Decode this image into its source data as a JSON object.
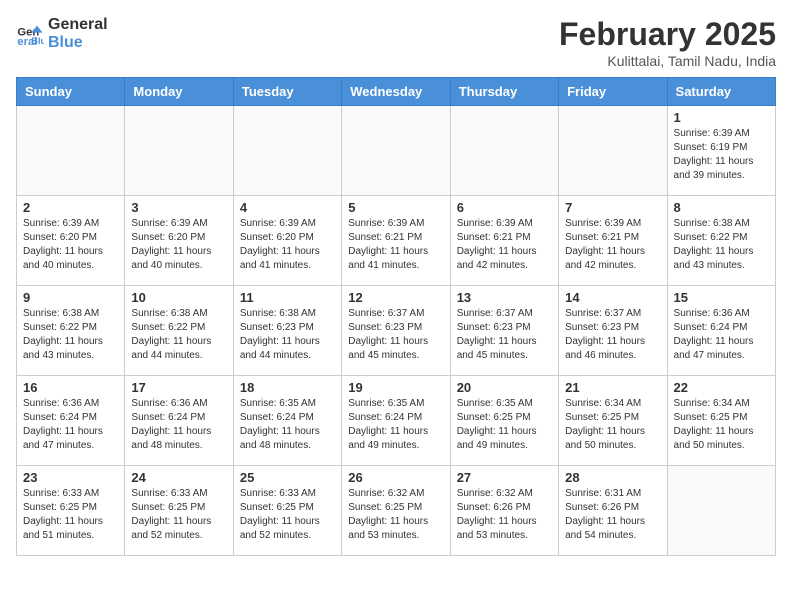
{
  "logo": {
    "general": "General",
    "blue": "Blue"
  },
  "title": "February 2025",
  "location": "Kulittalai, Tamil Nadu, India",
  "weekdays": [
    "Sunday",
    "Monday",
    "Tuesday",
    "Wednesday",
    "Thursday",
    "Friday",
    "Saturday"
  ],
  "weeks": [
    [
      {
        "day": "",
        "info": ""
      },
      {
        "day": "",
        "info": ""
      },
      {
        "day": "",
        "info": ""
      },
      {
        "day": "",
        "info": ""
      },
      {
        "day": "",
        "info": ""
      },
      {
        "day": "",
        "info": ""
      },
      {
        "day": "1",
        "info": "Sunrise: 6:39 AM\nSunset: 6:19 PM\nDaylight: 11 hours\nand 39 minutes."
      }
    ],
    [
      {
        "day": "2",
        "info": "Sunrise: 6:39 AM\nSunset: 6:20 PM\nDaylight: 11 hours\nand 40 minutes."
      },
      {
        "day": "3",
        "info": "Sunrise: 6:39 AM\nSunset: 6:20 PM\nDaylight: 11 hours\nand 40 minutes."
      },
      {
        "day": "4",
        "info": "Sunrise: 6:39 AM\nSunset: 6:20 PM\nDaylight: 11 hours\nand 41 minutes."
      },
      {
        "day": "5",
        "info": "Sunrise: 6:39 AM\nSunset: 6:21 PM\nDaylight: 11 hours\nand 41 minutes."
      },
      {
        "day": "6",
        "info": "Sunrise: 6:39 AM\nSunset: 6:21 PM\nDaylight: 11 hours\nand 42 minutes."
      },
      {
        "day": "7",
        "info": "Sunrise: 6:39 AM\nSunset: 6:21 PM\nDaylight: 11 hours\nand 42 minutes."
      },
      {
        "day": "8",
        "info": "Sunrise: 6:38 AM\nSunset: 6:22 PM\nDaylight: 11 hours\nand 43 minutes."
      }
    ],
    [
      {
        "day": "9",
        "info": "Sunrise: 6:38 AM\nSunset: 6:22 PM\nDaylight: 11 hours\nand 43 minutes."
      },
      {
        "day": "10",
        "info": "Sunrise: 6:38 AM\nSunset: 6:22 PM\nDaylight: 11 hours\nand 44 minutes."
      },
      {
        "day": "11",
        "info": "Sunrise: 6:38 AM\nSunset: 6:23 PM\nDaylight: 11 hours\nand 44 minutes."
      },
      {
        "day": "12",
        "info": "Sunrise: 6:37 AM\nSunset: 6:23 PM\nDaylight: 11 hours\nand 45 minutes."
      },
      {
        "day": "13",
        "info": "Sunrise: 6:37 AM\nSunset: 6:23 PM\nDaylight: 11 hours\nand 45 minutes."
      },
      {
        "day": "14",
        "info": "Sunrise: 6:37 AM\nSunset: 6:23 PM\nDaylight: 11 hours\nand 46 minutes."
      },
      {
        "day": "15",
        "info": "Sunrise: 6:36 AM\nSunset: 6:24 PM\nDaylight: 11 hours\nand 47 minutes."
      }
    ],
    [
      {
        "day": "16",
        "info": "Sunrise: 6:36 AM\nSunset: 6:24 PM\nDaylight: 11 hours\nand 47 minutes."
      },
      {
        "day": "17",
        "info": "Sunrise: 6:36 AM\nSunset: 6:24 PM\nDaylight: 11 hours\nand 48 minutes."
      },
      {
        "day": "18",
        "info": "Sunrise: 6:35 AM\nSunset: 6:24 PM\nDaylight: 11 hours\nand 48 minutes."
      },
      {
        "day": "19",
        "info": "Sunrise: 6:35 AM\nSunset: 6:24 PM\nDaylight: 11 hours\nand 49 minutes."
      },
      {
        "day": "20",
        "info": "Sunrise: 6:35 AM\nSunset: 6:25 PM\nDaylight: 11 hours\nand 49 minutes."
      },
      {
        "day": "21",
        "info": "Sunrise: 6:34 AM\nSunset: 6:25 PM\nDaylight: 11 hours\nand 50 minutes."
      },
      {
        "day": "22",
        "info": "Sunrise: 6:34 AM\nSunset: 6:25 PM\nDaylight: 11 hours\nand 50 minutes."
      }
    ],
    [
      {
        "day": "23",
        "info": "Sunrise: 6:33 AM\nSunset: 6:25 PM\nDaylight: 11 hours\nand 51 minutes."
      },
      {
        "day": "24",
        "info": "Sunrise: 6:33 AM\nSunset: 6:25 PM\nDaylight: 11 hours\nand 52 minutes."
      },
      {
        "day": "25",
        "info": "Sunrise: 6:33 AM\nSunset: 6:25 PM\nDaylight: 11 hours\nand 52 minutes."
      },
      {
        "day": "26",
        "info": "Sunrise: 6:32 AM\nSunset: 6:25 PM\nDaylight: 11 hours\nand 53 minutes."
      },
      {
        "day": "27",
        "info": "Sunrise: 6:32 AM\nSunset: 6:26 PM\nDaylight: 11 hours\nand 53 minutes."
      },
      {
        "day": "28",
        "info": "Sunrise: 6:31 AM\nSunset: 6:26 PM\nDaylight: 11 hours\nand 54 minutes."
      },
      {
        "day": "",
        "info": ""
      }
    ]
  ]
}
